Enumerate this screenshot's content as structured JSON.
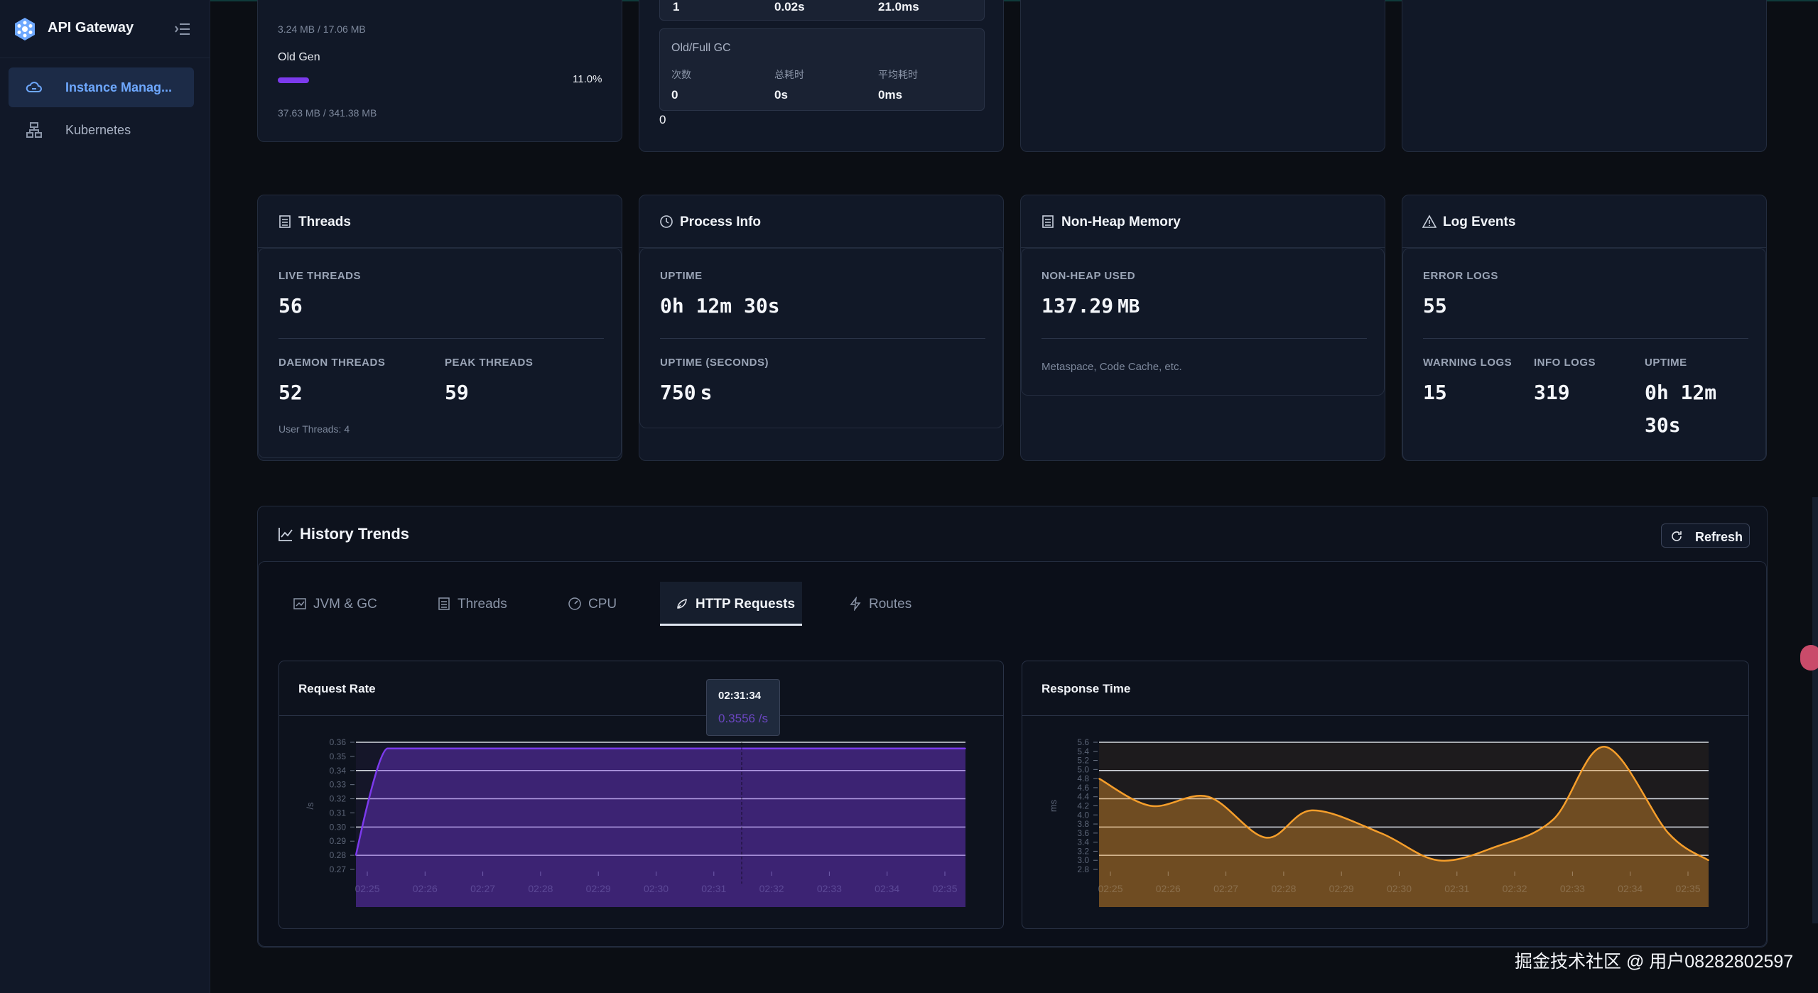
{
  "sidebar": {
    "brand": "API Gateway",
    "items": [
      {
        "label": "Instance Manag...",
        "icon": "cloud-icon",
        "active": true
      },
      {
        "label": "Kubernetes",
        "icon": "cluster-icon",
        "active": false
      }
    ]
  },
  "memory_card": {
    "young_usage": "3.24 MB / 17.06 MB",
    "old_gen_label": "Old Gen",
    "old_gen_percent": "11.0%",
    "old_gen_fraction": 0.11,
    "old_gen_usage": "37.63 MB / 341.38 MB"
  },
  "gc_card": {
    "young_row": [
      "1",
      "0.02s",
      "21.0ms"
    ],
    "old_title": "Old/Full GC",
    "columns": [
      "次数",
      "总耗时",
      "平均耗时"
    ],
    "old_values": [
      "0",
      "0s",
      "0ms"
    ],
    "footer": "0"
  },
  "threads": {
    "title": "Threads",
    "live_label": "LIVE THREADS",
    "live_value": "56",
    "daemon_label": "DAEMON THREADS",
    "daemon_value": "52",
    "peak_label": "PEAK THREADS",
    "peak_value": "59",
    "note": "User Threads: 4"
  },
  "process": {
    "title": "Process Info",
    "uptime_label": "UPTIME",
    "uptime_value": "0h 12m 30s",
    "uptime_sec_label": "UPTIME (SECONDS)",
    "uptime_sec_value": "750",
    "uptime_sec_unit": "s"
  },
  "nonheap": {
    "title": "Non-Heap Memory",
    "used_label": "NON-HEAP USED",
    "used_value": "137.29",
    "used_unit": "MB",
    "note": "Metaspace, Code Cache, etc."
  },
  "logs": {
    "title": "Log Events",
    "error_label": "ERROR LOGS",
    "error_value": "55",
    "warning_label": "WARNING LOGS",
    "warning_value": "15",
    "info_label": "INFO LOGS",
    "info_value": "319",
    "uptime_label": "UPTIME",
    "uptime_line1": "0h 12m",
    "uptime_line2": "30s"
  },
  "history": {
    "title": "History Trends",
    "refresh_label": "Refresh",
    "tabs": [
      {
        "label": "JVM & GC",
        "icon": "chart-icon"
      },
      {
        "label": "Threads",
        "icon": "list-icon"
      },
      {
        "label": "CPU",
        "icon": "gauge-icon"
      },
      {
        "label": "HTTP Requests",
        "icon": "rocket-icon",
        "active": true
      },
      {
        "label": "Routes",
        "icon": "lightning-icon"
      }
    ]
  },
  "tooltip": {
    "time": "02:31:34",
    "value": "0.3556 /s"
  },
  "colors": {
    "purple": "#7c3aed",
    "orange": "#f59e2b",
    "accent": "#6ea8fe"
  },
  "chart_data": [
    {
      "type": "area",
      "title": "Request Rate",
      "ylabel": "/s",
      "ylim": [
        0.27,
        0.36
      ],
      "yticks": [
        "0.36",
        "0.35",
        "0.34",
        "0.33",
        "0.32",
        "0.31",
        "0.30",
        "0.29",
        "0.28",
        "0.27"
      ],
      "x": [
        "02:25",
        "02:26",
        "02:27",
        "02:28",
        "02:29",
        "02:30",
        "02:31",
        "02:32",
        "02:33",
        "02:34",
        "02:35"
      ],
      "series": [
        {
          "values": [
            0.28,
            0.3556,
            0.3556,
            0.3556,
            0.3556,
            0.3556,
            0.3556,
            0.3556,
            0.3556,
            0.3556,
            0.3556,
            0.3556
          ]
        }
      ],
      "x_points": [
        0,
        1,
        2,
        3,
        4,
        5,
        6,
        7,
        8,
        9,
        10,
        10.6
      ],
      "grid": true
    },
    {
      "type": "area",
      "title": "Response Time",
      "ylabel": "ms",
      "ylim": [
        2.8,
        5.6
      ],
      "yticks": [
        "5.6",
        "5.4",
        "5.2",
        "5.0",
        "4.8",
        "4.6",
        "4.4",
        "4.2",
        "4.0",
        "3.8",
        "3.6",
        "3.4",
        "3.2",
        "3.0",
        "2.8"
      ],
      "x": [
        "02:25",
        "02:26",
        "02:27",
        "02:28",
        "02:29",
        "02:30",
        "02:31",
        "02:32",
        "02:33",
        "02:34",
        "02:35"
      ],
      "series": [
        {
          "values": [
            4.8,
            4.2,
            4.4,
            3.5,
            4.1,
            3.6,
            3.0,
            3.3,
            3.9,
            5.5,
            3.6,
            3.0
          ]
        }
      ],
      "x_points": [
        0,
        0.9,
        1.9,
        2.9,
        3.7,
        4.9,
        5.9,
        6.9,
        7.9,
        8.8,
        9.9,
        10.6
      ],
      "grid": true
    }
  ],
  "watermark": "掘金技术社区 @ 用户08282802597"
}
